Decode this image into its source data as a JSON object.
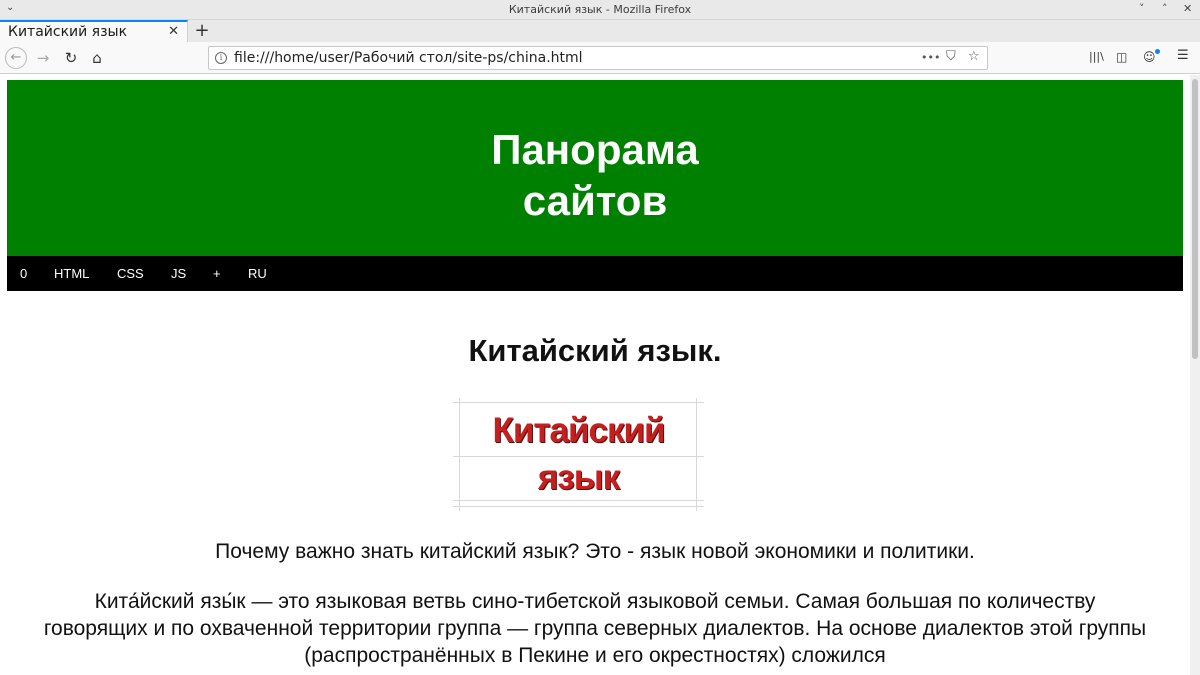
{
  "window": {
    "title": "Китайский язык - Mozilla Firefox",
    "controls": [
      "˄",
      "˅",
      "✕"
    ]
  },
  "tab": {
    "label": "Китайский язык",
    "close": "✕",
    "new_tab": "+"
  },
  "nav": {
    "back": "←",
    "forward": "→",
    "reload": "↻",
    "home": "⌂",
    "url": "file:///home/user/Рабочий стол/site-ps/china.html",
    "page_actions": "•••",
    "pocket": "⛉",
    "bookmark": "☆",
    "library": "|||\\",
    "sidebar": "◫",
    "account": "☺",
    "menu": "☰"
  },
  "site": {
    "title_line1": "Панорама",
    "title_line2": "сайтов",
    "menu": [
      "0",
      "HTML",
      "CSS",
      "JS",
      "+",
      "RU"
    ]
  },
  "article": {
    "heading": "Китайский язык.",
    "banner_line1": "Китайский",
    "banner_line2": "язык",
    "lead": "Почему важно знать китайский язык? Это - язык новой экономики и политики.",
    "paragraph": "Кита́йский язы́к — это языковая ветвь сино-тибетской языковой семьи. Самая большая по количеству говорящих и по охваченной территории группа — группа северных диалектов. На основе диалектов этой группы (распространённых в Пекине и его окрестностях) сложился"
  },
  "colors": {
    "header_bg": "#008000",
    "nav_bg": "#000000",
    "banner_text": "#c42020",
    "tab_accent": "#0a84ff"
  }
}
